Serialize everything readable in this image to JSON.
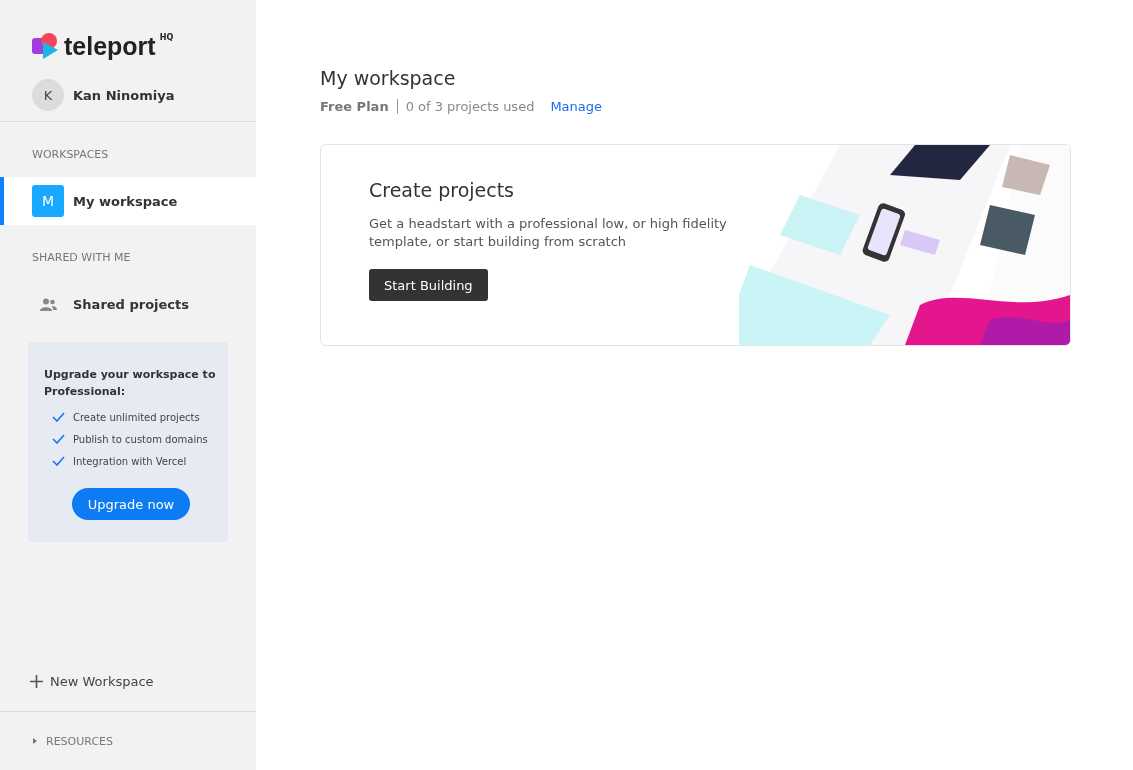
{
  "logo": {
    "name": "teleport",
    "suffix": "HQ"
  },
  "user": {
    "initial": "K",
    "name": "Kan Ninomiya"
  },
  "sidebar": {
    "sections": [
      {
        "heading": "WORKSPACES",
        "items": [
          {
            "kind": "workspace",
            "initial": "M",
            "label": "My workspace",
            "selected": true
          }
        ]
      },
      {
        "heading": "SHARED WITH ME",
        "items": [
          {
            "kind": "shared",
            "label": "Shared projects",
            "selected": false
          }
        ]
      }
    ],
    "upgrade": {
      "title": "Upgrade your workspace to Professional:",
      "features": [
        "Create unlimited projects",
        "Publish to custom domains",
        "Integration with Vercel"
      ],
      "button": "Upgrade now"
    },
    "new_workspace": "New Workspace",
    "resources": {
      "label": "RESOURCES",
      "expanded": false
    }
  },
  "workspace": {
    "title": "My workspace",
    "plan": "Free Plan",
    "usage": "0 of 3 projects used",
    "manage": "Manage"
  },
  "card": {
    "title": "Create projects",
    "description": "Get a headstart with a professional low, or high fidelity template, or start building from scratch",
    "button": "Start Building"
  }
}
